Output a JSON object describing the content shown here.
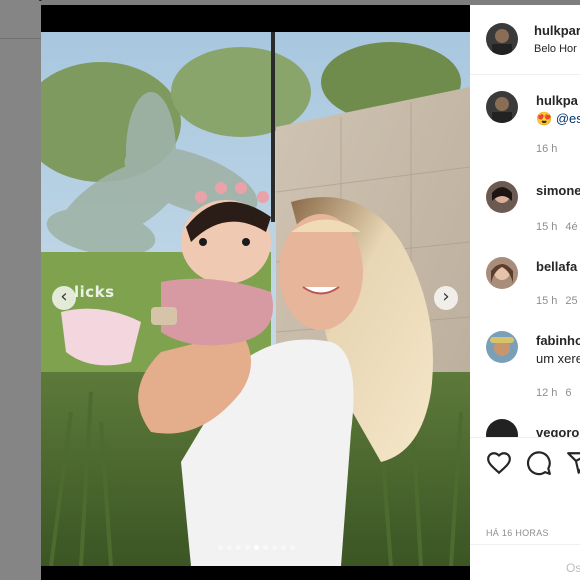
{
  "post": {
    "username": "hulkpar",
    "location": "Belo Hor",
    "watermark": "licks",
    "carousel_dots": 9,
    "active_dot": 4
  },
  "comments": [
    {
      "username": "hulkpa",
      "text_prefix": "😍 ",
      "mention": "@est",
      "time": "16 h",
      "likes": ""
    },
    {
      "username": "simone",
      "text": "",
      "time": "15 h",
      "likes": "4é"
    },
    {
      "username": "bellafa",
      "text": "",
      "time": "15 h",
      "likes": "25"
    },
    {
      "username": "fabinho",
      "text": "um xere",
      "time": "12 h",
      "likes": "6"
    },
    {
      "username": "vegoro",
      "text": "",
      "time": "",
      "likes": ""
    }
  ],
  "actions": {
    "like_icon": "heart-icon",
    "comment_icon": "comment-icon",
    "share_icon": "share-icon"
  },
  "timestamp": "HÁ 16 HORAS",
  "add_comment_placeholder": "Os",
  "colors": {
    "text": "#262626",
    "meta": "#8e8e8e",
    "link": "#00376b"
  }
}
